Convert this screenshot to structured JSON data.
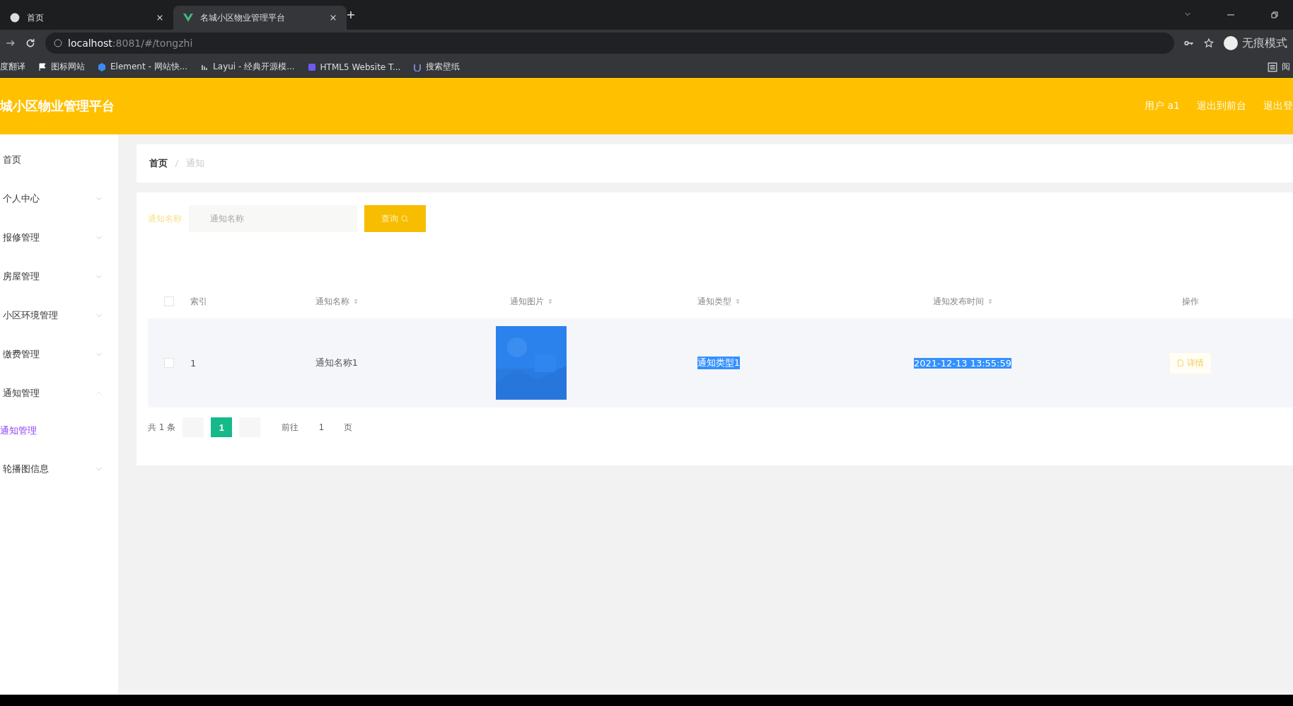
{
  "browser": {
    "tabs": [
      {
        "label": "首页",
        "selected": false
      },
      {
        "label": "名城小区物业管理平台",
        "selected": true
      }
    ],
    "url": {
      "host": "localhost",
      "rest": ":8081/#/tongzhi"
    },
    "bookmarks": [
      "度翻译",
      "图标网站",
      "Element - 网站快...",
      "Layui - 经典开源模...",
      "HTML5 Website T...",
      "搜索壁纸"
    ],
    "profile": "无痕模式",
    "reading_list": "阅"
  },
  "header": {
    "title": "城小区物业管理平台",
    "links": [
      "用户 a1",
      "退出到前台",
      "退出登"
    ]
  },
  "sidebar": {
    "items": [
      {
        "label": "首页",
        "kind": "link"
      },
      {
        "label": "个人中心",
        "kind": "menu",
        "expanded": false
      },
      {
        "label": "报修管理",
        "kind": "menu",
        "expanded": false
      },
      {
        "label": "房屋管理",
        "kind": "menu",
        "expanded": false
      },
      {
        "label": "小区环境管理",
        "kind": "menu",
        "expanded": false
      },
      {
        "label": "缴费管理",
        "kind": "menu",
        "expanded": false
      },
      {
        "label": "通知管理",
        "kind": "menu",
        "expanded": true,
        "children": [
          {
            "label": "通知管理",
            "selected": true
          }
        ]
      },
      {
        "label": "轮播图信息",
        "kind": "menu",
        "expanded": false
      }
    ]
  },
  "breadcrumb": [
    "首页",
    "通知"
  ],
  "search": {
    "label": "通知名称",
    "placeholder": "通知名称",
    "button": "查询"
  },
  "table": {
    "all_checked": false,
    "columns": [
      {
        "label": "索引",
        "sortable": false
      },
      {
        "label": "通知名称",
        "sortable": true
      },
      {
        "label": "通知图片",
        "sortable": true
      },
      {
        "label": "通知类型",
        "sortable": true
      },
      {
        "label": "通知发布时间",
        "sortable": true
      },
      {
        "label": "操作",
        "sortable": false
      }
    ],
    "rows": [
      {
        "checked": false,
        "index": "1",
        "name": "通知名称1",
        "type": {
          "text": "通知类型1",
          "highlighted": true
        },
        "time": {
          "text": "2021-12-13 13:55:59",
          "highlighted": true
        },
        "action": "详情"
      }
    ]
  },
  "pagination": {
    "total": "共 1 条",
    "pages": [
      {
        "label": "1",
        "selected": true
      }
    ],
    "goto": "前往",
    "page_value": "1",
    "page_suffix": "页"
  }
}
